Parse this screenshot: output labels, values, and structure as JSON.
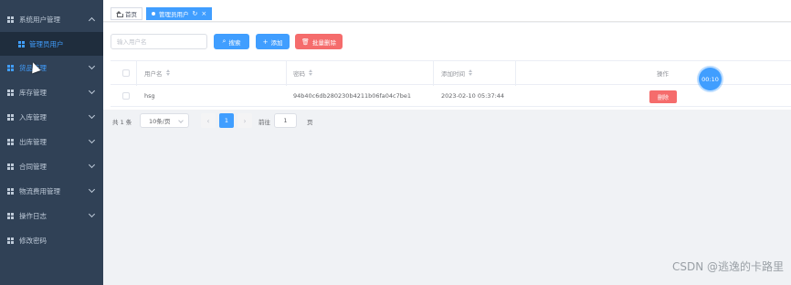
{
  "sidebar": {
    "items": [
      {
        "label": "系统用户管理",
        "expanded": true
      },
      {
        "label": "管理员用户"
      },
      {
        "label": "货品管理"
      },
      {
        "label": "库存管理"
      },
      {
        "label": "入库管理"
      },
      {
        "label": "出库管理"
      },
      {
        "label": "合同管理"
      },
      {
        "label": "物流费用管理"
      },
      {
        "label": "操作日志"
      },
      {
        "label": "修改密码"
      }
    ]
  },
  "tags": {
    "home": "首页",
    "active": "管理员用户",
    "refresh_glyph": "↻",
    "close_glyph": "×"
  },
  "toolbar": {
    "search_placeholder": "输入用户名",
    "search_label": "搜索",
    "add_label": "添加",
    "batch_delete_label": "批量删除"
  },
  "table": {
    "headers": [
      "用户名",
      "密码",
      "添加时间",
      "操作"
    ],
    "rows": [
      {
        "username": "hsg",
        "password": "94b40c6db280230b4211b06fa04c7be1",
        "created": "2023-02-10 05:37:44",
        "action": "删除"
      }
    ]
  },
  "timer": "00:10",
  "pagination": {
    "total": "共 1 条",
    "page_size": "10条/页",
    "current_page": "1",
    "goto_label": "前往",
    "jump_value": "1",
    "page_suffix": "页"
  },
  "watermark": "CSDN @逃逸的卡路里",
  "colors": {
    "sidebar_bg": "#304156",
    "primary": "#409eff",
    "danger": "#f56c6c"
  }
}
